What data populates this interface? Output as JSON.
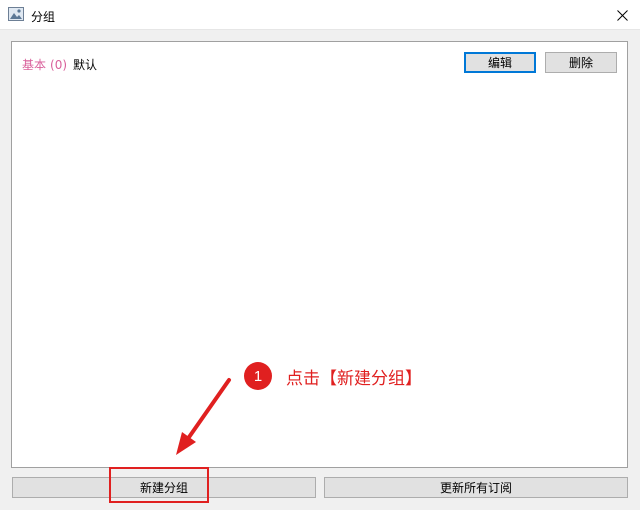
{
  "window": {
    "title": "分组",
    "icon": "app-icon",
    "close_icon": "close-icon"
  },
  "groups": [
    {
      "name": "基本",
      "count": "(0)",
      "tag": "默认"
    }
  ],
  "toolbar": {
    "edit_label": "编辑",
    "delete_label": "删除"
  },
  "footer": {
    "new_group_label": "新建分组",
    "update_all_label": "更新所有订阅"
  },
  "annotation": {
    "step_number": "1",
    "step_text": "点击【新建分组】",
    "color": "#e02020"
  },
  "colors": {
    "group_name": "#d9609b",
    "focus_border": "#0078d7"
  }
}
